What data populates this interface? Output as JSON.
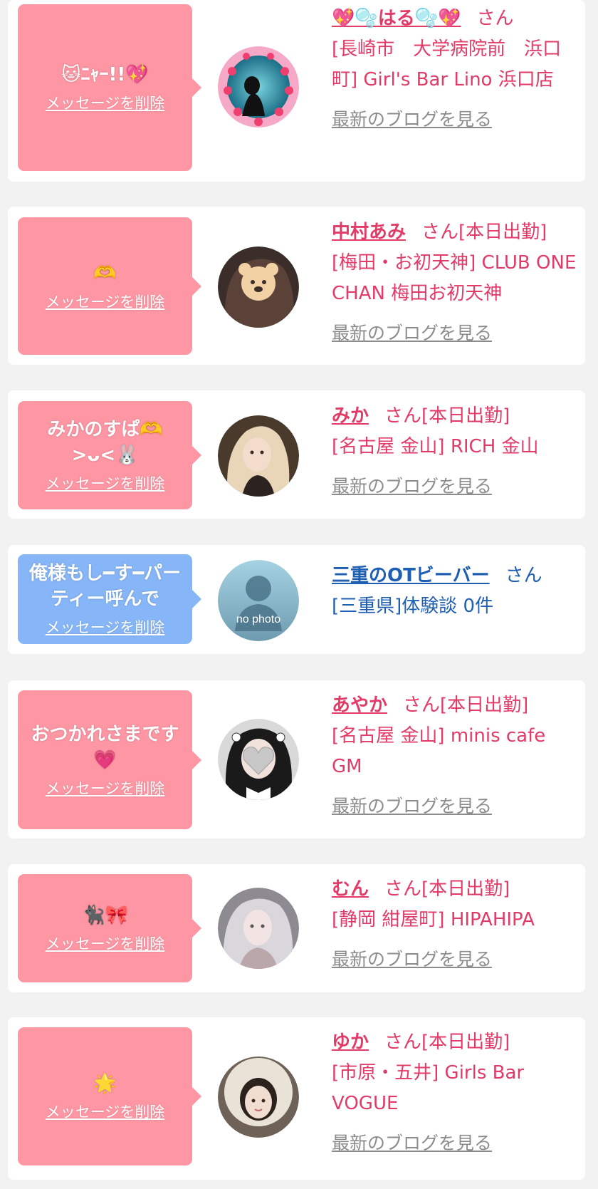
{
  "delete_label": "メッセージを削除",
  "blog_label": "最新のブログを見る",
  "san_label": "さん",
  "colors": {
    "bubble_pink": "#fe96a4",
    "bubble_blue": "#86b6f7",
    "name_pink": "#e23b67",
    "name_blue": "#1f5fb3",
    "link_gray": "#8c8c8c"
  },
  "entries": [
    {
      "message": "🐱ﾆｬｰ!!💖",
      "name": "💖🫧はる🫧💖",
      "san": "さん",
      "status": "",
      "shop": "[長崎市　大学病院前　浜口町] Girl's Bar Lino 浜口店",
      "blog": "最新のブログを見る",
      "avatar": "avatar-heart-frame"
    },
    {
      "message": "🫶",
      "name": "中村あみ",
      "san": "さん",
      "status": "[本日出勤]",
      "shop": "[梅田・お初天神] CLUB ONE CHAN 梅田お初天神",
      "blog": "最新のブログを見る",
      "avatar": "avatar-bear-sticker"
    },
    {
      "message": "みかのすぱ🫶>ᴗ<🐰",
      "name": "みか",
      "san": "さん",
      "status": "[本日出勤]",
      "shop": "[名古屋 金山] RICH 金山",
      "blog": "最新のブログを見る",
      "avatar": "avatar-blonde"
    },
    {
      "message": "俺様もし━す━パーティー呼んで",
      "name": "三重のOTビーバー",
      "san": "さん",
      "status": "",
      "shop": "[三重県]体験談 0件",
      "blog": "",
      "avatar": "avatar-no-photo",
      "no_photo_text": "no photo"
    },
    {
      "message": "おつかれさまです💗",
      "name": "あやか",
      "san": "さん",
      "status": "[本日出勤]",
      "shop": "[名古屋 金山] minis cafe GM",
      "blog": "最新のブログを見る",
      "avatar": "avatar-heart-sticker"
    },
    {
      "message": "🐈‍⬛🎀",
      "name": "むん",
      "san": "さん",
      "status": "[本日出勤]",
      "shop": "[静岡 紺屋町] HIPAHIPA",
      "blog": "最新のブログを見る",
      "avatar": "avatar-pale"
    },
    {
      "message": "🌟",
      "name": "ゆか",
      "san": "さん",
      "status": "[本日出勤]",
      "shop": "[市原・五井] Girls Bar VOGUE",
      "blog": "最新のブログを見る",
      "avatar": "avatar-fur-hood"
    }
  ]
}
